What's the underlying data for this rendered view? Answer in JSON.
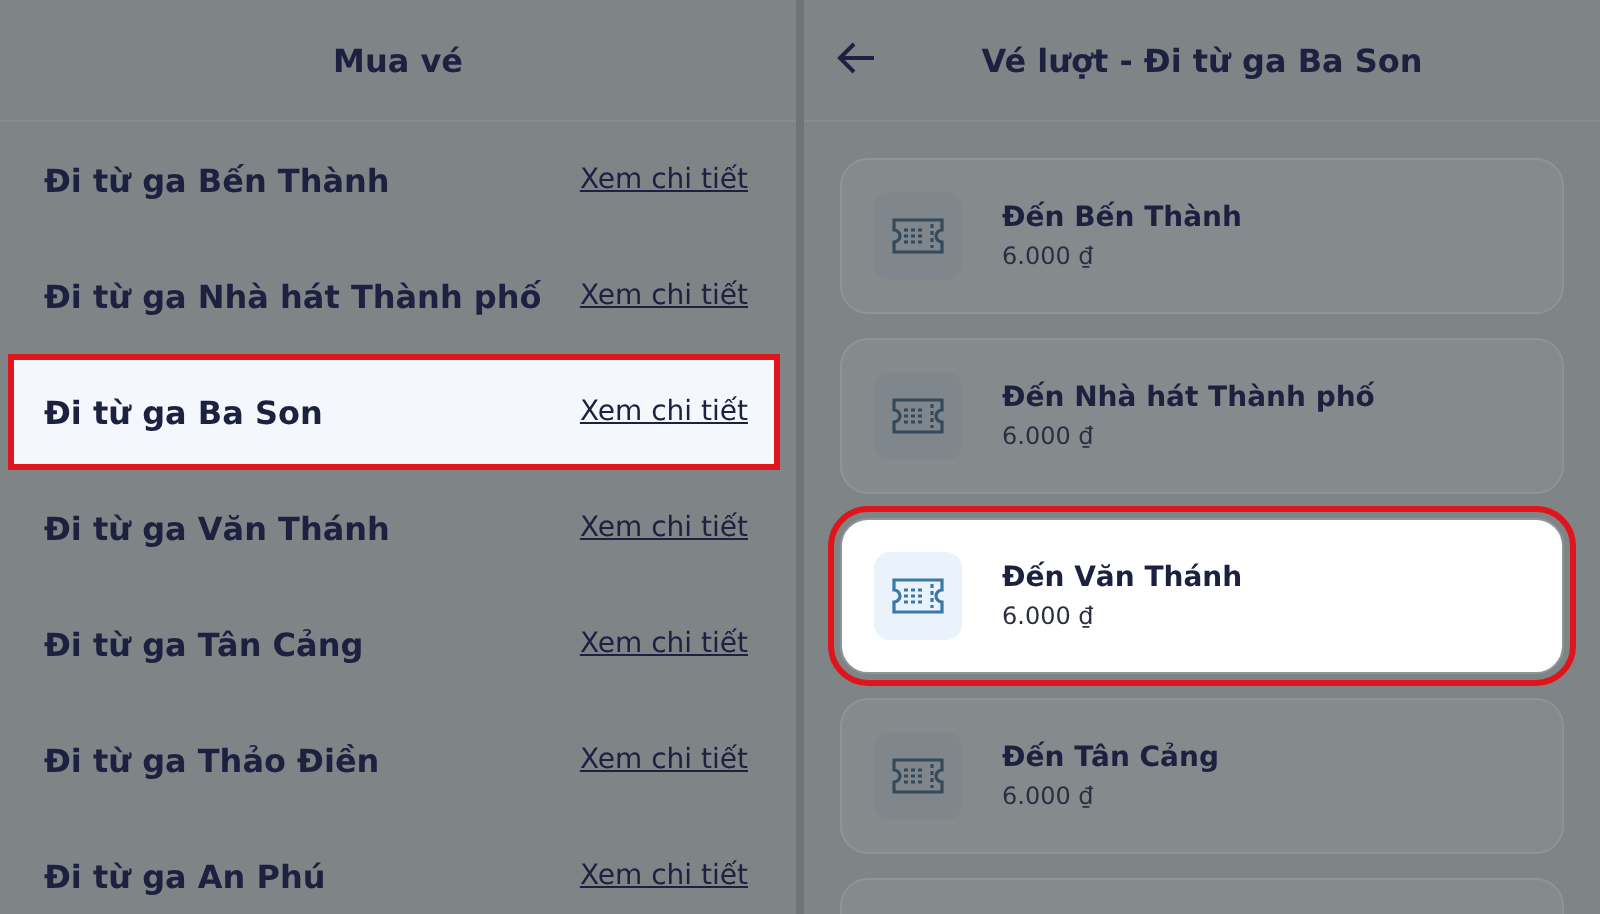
{
  "left_screen": {
    "title": "Mua vé",
    "stations": [
      {
        "name": "Đi từ ga Bến Thành",
        "link": "Xem chi tiết",
        "selected": false
      },
      {
        "name": "Đi từ ga Nhà hát Thành phố",
        "link": "Xem chi tiết",
        "selected": false
      },
      {
        "name": "Đi từ ga Ba Son",
        "link": "Xem chi tiết",
        "selected": true
      },
      {
        "name": "Đi từ ga Văn Thánh",
        "link": "Xem chi tiết",
        "selected": false
      },
      {
        "name": "Đi từ ga Tân Cảng",
        "link": "Xem chi tiết",
        "selected": false
      },
      {
        "name": "Đi từ ga Thảo Điền",
        "link": "Xem chi tiết",
        "selected": false
      },
      {
        "name": "Đi từ ga An Phú",
        "link": "Xem chi tiết",
        "selected": false
      }
    ]
  },
  "right_screen": {
    "title": "Vé lượt - Đi từ ga Ba Son",
    "tickets": [
      {
        "destination": "Đến Bến Thành",
        "price": "6.000 ₫",
        "selected": false
      },
      {
        "destination": "Đến Nhà hát Thành phố",
        "price": "6.000 ₫",
        "selected": false
      },
      {
        "destination": "Đến Văn Thánh",
        "price": "6.000 ₫",
        "selected": true
      },
      {
        "destination": "Đến Tân Cảng",
        "price": "6.000 ₫",
        "selected": false
      }
    ]
  }
}
